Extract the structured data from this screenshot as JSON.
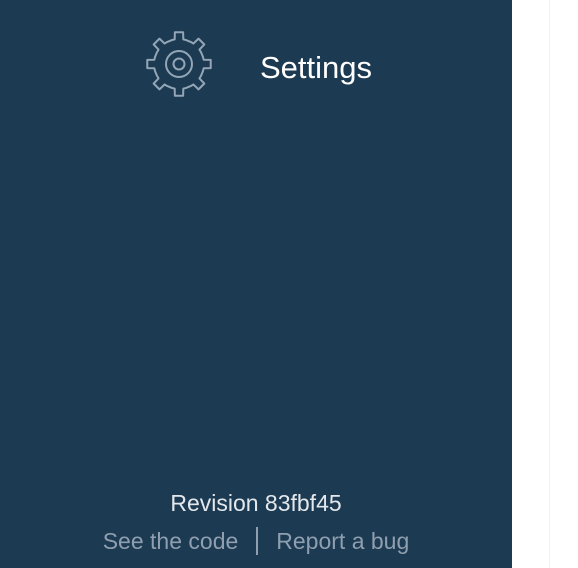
{
  "sidebar": {
    "settings": {
      "label": "Settings",
      "icon": "gear-icon"
    },
    "footer": {
      "revision": "Revision 83fbf45",
      "see_code": "See the code",
      "report_bug": "Report a bug"
    }
  },
  "colors": {
    "sidebar_bg": "#1c3a52",
    "text_primary": "#ffffff",
    "text_muted": "#8f9faf",
    "icon_stroke": "#94a6b6"
  }
}
